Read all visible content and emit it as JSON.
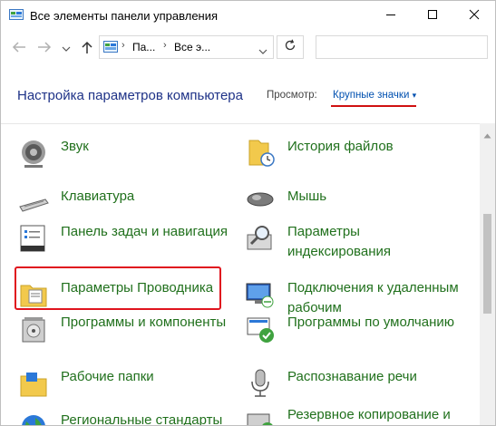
{
  "window": {
    "title": "Все элементы панели управления",
    "controls": {
      "minimize": "minimize",
      "maximize": "maximize",
      "close": "close"
    }
  },
  "navigation": {
    "breadcrumbs": [
      "Па...",
      "Все э..."
    ],
    "search_placeholder": ""
  },
  "header": {
    "title": "Настройка параметров компьютера",
    "view_label": "Просмотр:",
    "view_value": "Крупные значки"
  },
  "items_left": [
    {
      "label": "Звук",
      "icon": "speaker-icon"
    },
    {
      "label": "Клавиатура",
      "icon": "keyboard-icon"
    },
    {
      "label": "Панель задач и навигация",
      "icon": "taskbar-icon"
    },
    {
      "label": "Параметры Проводника",
      "icon": "folder-options-icon"
    },
    {
      "label": "Программы и компоненты",
      "icon": "programs-icon"
    },
    {
      "label": "Рабочие папки",
      "icon": "work-folders-icon"
    },
    {
      "label": "Региональные стандарты",
      "icon": "globe-icon"
    }
  ],
  "items_right": [
    {
      "label": "История файлов",
      "icon": "file-history-icon"
    },
    {
      "label": "Мышь",
      "icon": "mouse-icon"
    },
    {
      "label": "Параметры индексирования",
      "icon": "indexing-icon"
    },
    {
      "label": "Подключения к удаленным рабочим",
      "icon": "remote-desktop-icon"
    },
    {
      "label": "Программы по умолчанию",
      "icon": "default-programs-icon"
    },
    {
      "label": "Распознавание речи",
      "icon": "microphone-icon"
    },
    {
      "label": "Резервное копирование и",
      "icon": "backup-icon"
    }
  ],
  "colors": {
    "link_green": "#20701c",
    "header_blue": "#1e3287",
    "highlight_red": "#e0141e"
  }
}
